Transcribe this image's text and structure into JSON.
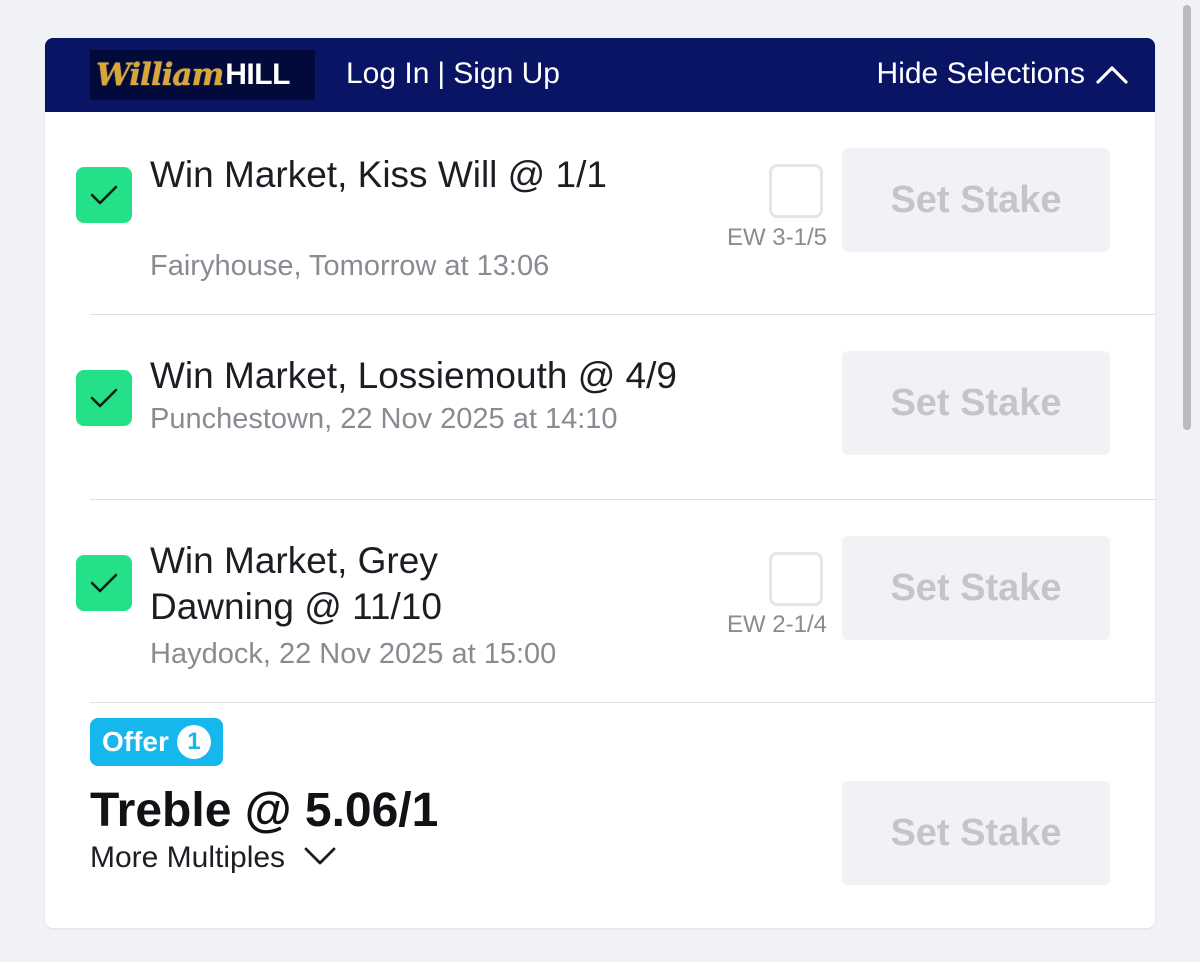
{
  "header": {
    "logo": {
      "script": "William",
      "block": "HILL",
      "color": "#d8a73a"
    },
    "login_label": "Log In",
    "separator": "|",
    "signup_label": "Sign Up",
    "hide_selections_label": "Hide Selections",
    "background": "#0a1464"
  },
  "selections": [
    {
      "title": "Win Market, Kiss Will @ 1/1",
      "subtitle": "Fairyhouse, Tomorrow at 13:06",
      "checked": true,
      "each_way": {
        "label": "EW 3-1/5",
        "checked": false
      },
      "stake_label": "Set Stake"
    },
    {
      "title": "Win Market, Lossiemouth @ 4/9",
      "subtitle": "Punchestown, 22 Nov 2025 at 14:10",
      "checked": true,
      "stake_label": "Set Stake"
    },
    {
      "title": "Win Market, Grey Dawning @ 11/10",
      "subtitle": "Haydock, 22 Nov 2025 at 15:00",
      "checked": true,
      "each_way": {
        "label": "EW 2-1/4",
        "checked": false
      },
      "stake_label": "Set Stake"
    }
  ],
  "multiple": {
    "offer_label": "Offer",
    "offer_count": "1",
    "title": "Treble @ 5.06/1",
    "more_label": "More Multiples",
    "stake_label": "Set Stake"
  },
  "colors": {
    "check_green": "#23e089",
    "offer_blue": "#16b7ec",
    "disabled_button": "#f1f2f5"
  }
}
